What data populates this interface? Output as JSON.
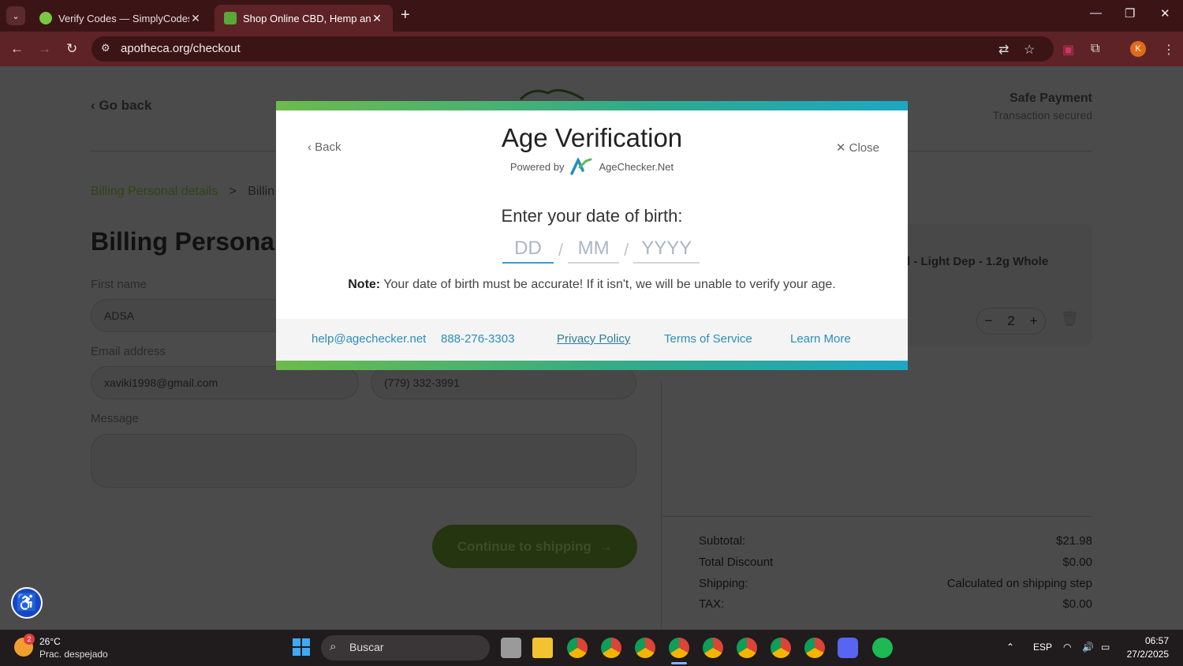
{
  "browser": {
    "tabs": [
      {
        "title": "Verify Codes — SimplyCodes",
        "favicon_color": "#7ac943"
      },
      {
        "title": "Shop Online CBD, Hemp and O",
        "favicon_color": "#5aa838"
      }
    ],
    "url": "apotheca.org/checkout",
    "profile_initial": "K"
  },
  "page": {
    "go_back": "Go back",
    "safe_title": "Safe Payment",
    "safe_sub": "Transaction secured",
    "breadcrumb": {
      "step1": "Billing Personal details",
      "sep": ">",
      "step2": "Billin"
    },
    "heading": "Billing Personal",
    "labels": {
      "first_name": "First name",
      "email": "Email address",
      "message": "Message"
    },
    "values": {
      "first_name": "ADSA",
      "email": "xaviki1998@gmail.com",
      "phone": "(779) 332-3991"
    },
    "continue_button": "Continue to shipping",
    "cart": {
      "item_name": "l - Light Dep - 1.2g Whole",
      "quantity": "2"
    },
    "summary": [
      {
        "label": "Subtotal:",
        "value": "$21.98"
      },
      {
        "label": "Total Discount",
        "value": "$0.00"
      },
      {
        "label": "Shipping:",
        "value": "Calculated on shipping step"
      },
      {
        "label": "TAX:",
        "value": "$0.00"
      }
    ]
  },
  "modal": {
    "back": "Back",
    "close": "Close",
    "title": "Age Verification",
    "powered_by": "Powered by",
    "provider": "AgeChecker.Net",
    "prompt": "Enter your date of birth:",
    "dob_placeholders": {
      "day": "DD",
      "month": "MM",
      "year": "YYYY"
    },
    "note_label": "Note:",
    "note_text": "Your date of birth must be accurate! If it isn't, we will be unable to verify your age.",
    "footer": {
      "email": "help@agechecker.net",
      "phone": "888-276-3303",
      "privacy": "Privacy Policy",
      "terms": "Terms of Service",
      "learn_more": "Learn More"
    }
  },
  "taskbar": {
    "weather_temp": "26°C",
    "weather_desc": "Prac. despejado",
    "weather_badge": "2",
    "search_placeholder": "Buscar",
    "language": "ESP",
    "time": "06:57",
    "date": "27/2/2025"
  }
}
